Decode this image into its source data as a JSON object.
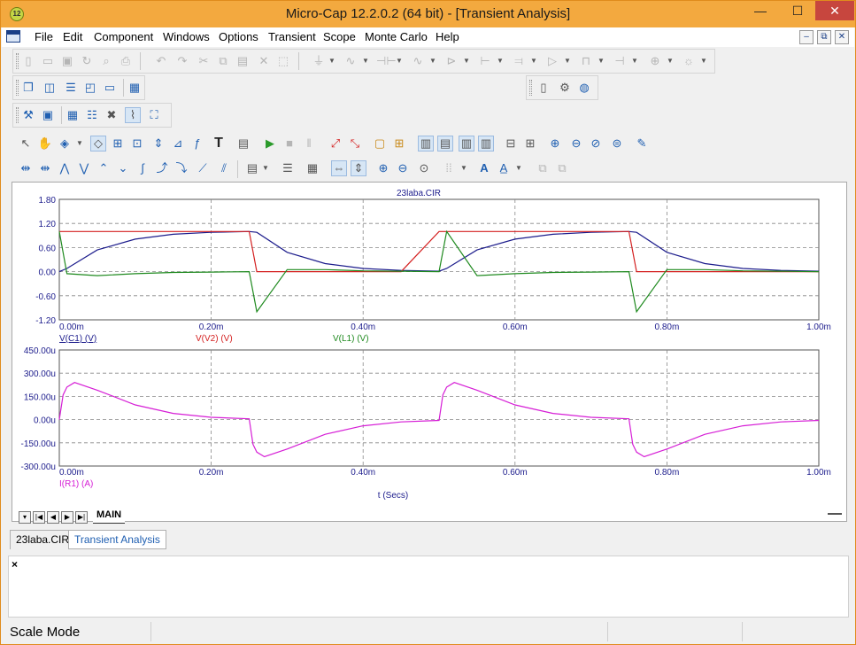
{
  "window": {
    "title": "Micro-Cap 12.2.0.2 (64 bit) - [Transient Analysis]",
    "app_badge": "12",
    "min_glyph": "—",
    "max_glyph": "☐",
    "close_glyph": "✕"
  },
  "menu": [
    "File",
    "Edit",
    "Component",
    "Windows",
    "Options",
    "Transient",
    "Scope",
    "Monte Carlo",
    "Help"
  ],
  "mdi_controls": [
    "–",
    "⧉",
    "✕"
  ],
  "plot": {
    "circuit_title": "23laba.CIR",
    "x_ticks": [
      "0.00m",
      "0.20m",
      "0.40m",
      "0.60m",
      "0.80m",
      "1.00m"
    ],
    "x_label": "t (Secs)",
    "top": {
      "y_ticks": [
        "1.80",
        "1.20",
        "0.60",
        "0.00",
        "-0.60",
        "-1.20"
      ],
      "traces": [
        {
          "name": "V(C1) (V)",
          "color": "#1c1c8c"
        },
        {
          "name": "V(V2) (V)",
          "color": "#d42020"
        },
        {
          "name": "V(L1) (V)",
          "color": "#1f8a1f"
        }
      ]
    },
    "bottom": {
      "y_ticks": [
        "450.00u",
        "300.00u",
        "150.00u",
        "0.00u",
        "-150.00u",
        "-300.00u"
      ],
      "traces": [
        {
          "name": "I(R1) (A)",
          "color": "#d61ed6"
        }
      ]
    }
  },
  "chart_data": [
    {
      "type": "line",
      "title": "23laba.CIR",
      "xlabel": "t (Secs)",
      "xlim": [
        0,
        0.001
      ],
      "ylim": [
        -1.2,
        1.8
      ],
      "x": [
        0,
        1e-05,
        5e-05,
        0.0001,
        0.00015,
        0.0002,
        0.00025,
        0.00026,
        0.0003,
        0.00035,
        0.0004,
        0.00045,
        0.0005,
        0.00051,
        0.00055,
        0.0006,
        0.00065,
        0.0007,
        0.00075,
        0.00076,
        0.0008,
        0.00085,
        0.0009,
        0.00095,
        0.001
      ],
      "series": [
        {
          "name": "V(C1) (V)",
          "values": [
            0,
            0.08,
            0.54,
            0.81,
            0.93,
            0.98,
            1.0,
            0.98,
            0.48,
            0.2,
            0.08,
            0.03,
            0.01,
            0.08,
            0.54,
            0.81,
            0.93,
            0.98,
            1.0,
            0.98,
            0.48,
            0.2,
            0.08,
            0.03,
            0.01
          ]
        },
        {
          "name": "V(V2) (V)",
          "values": [
            1,
            1,
            1,
            1,
            1,
            1,
            1,
            0,
            0,
            0,
            0,
            0,
            1,
            1,
            1,
            1,
            1,
            1,
            1,
            0,
            0,
            0,
            0,
            0,
            0
          ]
        },
        {
          "name": "V(L1) (V)",
          "values": [
            1.0,
            -0.05,
            -0.1,
            -0.05,
            -0.02,
            -0.01,
            0,
            -1.0,
            0.05,
            0.05,
            0.02,
            0.01,
            0,
            1.0,
            -0.1,
            -0.05,
            -0.02,
            -0.01,
            0,
            -1.0,
            0.05,
            0.05,
            0.02,
            0.01,
            0
          ]
        }
      ]
    },
    {
      "type": "line",
      "xlabel": "t (Secs)",
      "xlim": [
        0,
        0.001
      ],
      "ylim": [
        -0.0003,
        0.00045
      ],
      "x": [
        0,
        5e-06,
        1e-05,
        2e-05,
        5e-05,
        0.0001,
        0.00015,
        0.0002,
        0.00025,
        0.000255,
        0.00026,
        0.00027,
        0.0003,
        0.00035,
        0.0004,
        0.00045,
        0.0005,
        0.000505,
        0.00051,
        0.00052,
        0.00055,
        0.0006,
        0.00065,
        0.0007,
        0.00075,
        0.000755,
        0.00076,
        0.00077,
        0.0008,
        0.00085,
        0.0009,
        0.00095,
        0.001
      ],
      "series": [
        {
          "name": "I(R1) (A)",
          "values": [
            0,
            0.00016,
            0.00021,
            0.00024,
            0.00019,
            9.5e-05,
            4e-05,
            1.5e-05,
            5e-06,
            -0.00016,
            -0.00021,
            -0.00024,
            -0.00019,
            -9.5e-05,
            -4e-05,
            -1.5e-05,
            -5e-06,
            0.00016,
            0.00021,
            0.00024,
            0.00019,
            9.5e-05,
            4e-05,
            1.5e-05,
            5e-06,
            -0.00016,
            -0.00021,
            -0.00024,
            -0.00019,
            -9.5e-05,
            -4e-05,
            -1.5e-05,
            -5e-06
          ]
        }
      ]
    }
  ],
  "tabs": {
    "nav": [
      "▾",
      "|◀",
      "◀",
      "▶",
      "▶|"
    ],
    "page": "MAIN"
  },
  "doc_tabs": [
    "23laba.CIR",
    "Transient Analysis"
  ],
  "output_close": "×",
  "status": "Scale Mode"
}
